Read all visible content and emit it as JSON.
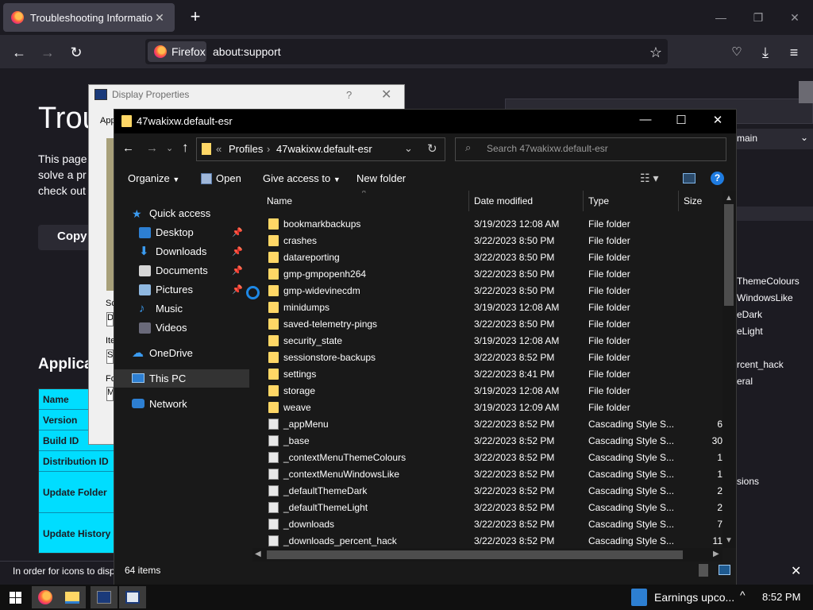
{
  "firefox": {
    "tab_title": "Troubleshooting Information",
    "tab_close": "✕",
    "new_tab": "+",
    "identity_label": "Firefox",
    "url": "about:support",
    "window_controls": [
      "—",
      "❐",
      "✕"
    ]
  },
  "support_page": {
    "title": "Trou",
    "description": "This page\nsolve a pr\ncheck out",
    "copy_button": "Copy",
    "section_heading": "Applica",
    "basics_rows": [
      "Name",
      "Version",
      "Build ID",
      "Distribution ID",
      "Update Folder",
      "Update History"
    ],
    "right_select": "main",
    "right_labels": [
      "ThemeColours",
      "WindowsLike",
      "eDark",
      "eLight",
      "rcent_hack",
      "eral",
      "sions"
    ],
    "bottom_hint": "In order for icons to display"
  },
  "display_properties": {
    "title": "Display Properties",
    "help": "?",
    "close": "✕",
    "tab_label": "App",
    "labels": [
      "Sc",
      "Ite",
      "Fo"
    ],
    "fields": [
      "D",
      "S",
      "M"
    ]
  },
  "explorer": {
    "title": "47wakixw.default-esr",
    "controls": {
      "minimize": "—",
      "maximize": "☐",
      "close": "✕"
    },
    "breadcrumb": {
      "prefix": "«",
      "parent": "Profiles",
      "sep": "›",
      "current": "47wakixw.default-esr"
    },
    "search_placeholder": "Search 47wakixw.default-esr",
    "toolbar": {
      "organize": "Organize",
      "open": "Open",
      "give_access": "Give access to",
      "new_folder": "New folder"
    },
    "nav": [
      {
        "label": "Quick access",
        "icon": "star-icon",
        "pinned": false
      },
      {
        "label": "Desktop",
        "icon": "desktop-icon",
        "pinned": true
      },
      {
        "label": "Downloads",
        "icon": "download-icon",
        "pinned": true
      },
      {
        "label": "Documents",
        "icon": "documents-icon",
        "pinned": true
      },
      {
        "label": "Pictures",
        "icon": "pictures-icon",
        "pinned": true
      },
      {
        "label": "Music",
        "icon": "music-icon",
        "pinned": false
      },
      {
        "label": "Videos",
        "icon": "videos-icon",
        "pinned": false
      },
      {
        "label": "OneDrive",
        "icon": "cloud-icon",
        "pinned": false
      },
      {
        "label": "This PC",
        "icon": "pc-icon",
        "pinned": false
      },
      {
        "label": "Network",
        "icon": "network-icon",
        "pinned": false
      }
    ],
    "pin_glyph": "📌",
    "columns": {
      "name": "Name",
      "date": "Date modified",
      "type": "Type",
      "size": "Size"
    },
    "files": [
      {
        "name": "bookmarkbackups",
        "date": "3/19/2023 12:08 AM",
        "type": "File folder",
        "size": "",
        "kind": "folder"
      },
      {
        "name": "crashes",
        "date": "3/22/2023 8:50 PM",
        "type": "File folder",
        "size": "",
        "kind": "folder"
      },
      {
        "name": "datareporting",
        "date": "3/22/2023 8:50 PM",
        "type": "File folder",
        "size": "",
        "kind": "folder"
      },
      {
        "name": "gmp-gmpopenh264",
        "date": "3/22/2023 8:50 PM",
        "type": "File folder",
        "size": "",
        "kind": "folder"
      },
      {
        "name": "gmp-widevinecdm",
        "date": "3/22/2023 8:50 PM",
        "type": "File folder",
        "size": "",
        "kind": "folder"
      },
      {
        "name": "minidumps",
        "date": "3/19/2023 12:08 AM",
        "type": "File folder",
        "size": "",
        "kind": "folder"
      },
      {
        "name": "saved-telemetry-pings",
        "date": "3/22/2023 8:50 PM",
        "type": "File folder",
        "size": "",
        "kind": "folder"
      },
      {
        "name": "security_state",
        "date": "3/19/2023 12:08 AM",
        "type": "File folder",
        "size": "",
        "kind": "folder"
      },
      {
        "name": "sessionstore-backups",
        "date": "3/22/2023 8:52 PM",
        "type": "File folder",
        "size": "",
        "kind": "folder"
      },
      {
        "name": "settings",
        "date": "3/22/2023 8:41 PM",
        "type": "File folder",
        "size": "",
        "kind": "folder"
      },
      {
        "name": "storage",
        "date": "3/19/2023 12:08 AM",
        "type": "File folder",
        "size": "",
        "kind": "folder"
      },
      {
        "name": "weave",
        "date": "3/19/2023 12:09 AM",
        "type": "File folder",
        "size": "",
        "kind": "folder"
      },
      {
        "name": "_appMenu",
        "date": "3/22/2023 8:52 PM",
        "type": "Cascading Style S...",
        "size": "6",
        "kind": "file"
      },
      {
        "name": "_base",
        "date": "3/22/2023 8:52 PM",
        "type": "Cascading Style S...",
        "size": "30",
        "kind": "file"
      },
      {
        "name": "_contextMenuThemeColours",
        "date": "3/22/2023 8:52 PM",
        "type": "Cascading Style S...",
        "size": "1",
        "kind": "file"
      },
      {
        "name": "_contextMenuWindowsLike",
        "date": "3/22/2023 8:52 PM",
        "type": "Cascading Style S...",
        "size": "1",
        "kind": "file"
      },
      {
        "name": "_defaultThemeDark",
        "date": "3/22/2023 8:52 PM",
        "type": "Cascading Style S...",
        "size": "2",
        "kind": "file"
      },
      {
        "name": "_defaultThemeLight",
        "date": "3/22/2023 8:52 PM",
        "type": "Cascading Style S...",
        "size": "2",
        "kind": "file"
      },
      {
        "name": "_downloads",
        "date": "3/22/2023 8:52 PM",
        "type": "Cascading Style S...",
        "size": "7",
        "kind": "file"
      },
      {
        "name": "_downloads_percent_hack",
        "date": "3/22/2023 8:52 PM",
        "type": "Cascading Style S...",
        "size": "11",
        "kind": "file"
      }
    ],
    "status": "64 items"
  },
  "taskbar": {
    "news": "Earnings upco...",
    "time": "8:52 PM",
    "chevron": "^"
  },
  "colors": {
    "firefox_bg": "#1c1b22",
    "basics_cyan": "#00ddff",
    "folder_yellow": "#ffd766",
    "accent_blue": "#1e88e5"
  }
}
